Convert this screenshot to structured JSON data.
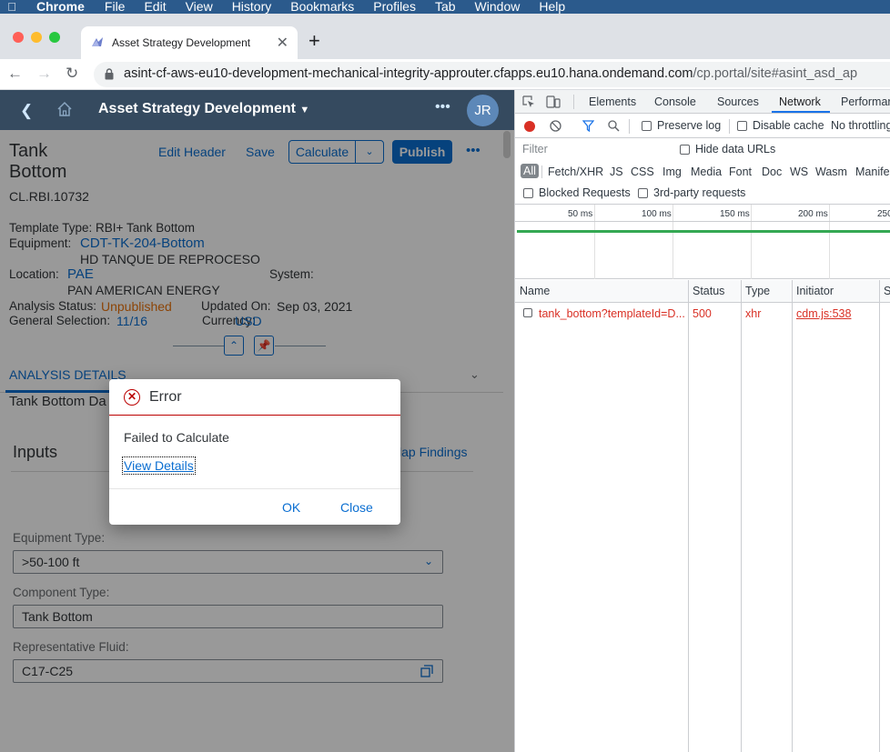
{
  "menubar": {
    "app": "Chrome",
    "items": [
      "File",
      "Edit",
      "View",
      "History",
      "Bookmarks",
      "Profiles",
      "Tab",
      "Window",
      "Help"
    ]
  },
  "browser": {
    "tab_title": "Asset Strategy Development",
    "url_main": "asint-cf-aws-eu10-development-mechanical-integrity-approuter.cfapps.eu10.hana.ondemand.com",
    "url_path": "/cp.portal/site#asint_asd_ap"
  },
  "shell": {
    "title": "Asset Strategy Development",
    "avatar": "JR"
  },
  "header": {
    "title": "Tank Bottom",
    "id": "CL.RBI.10732",
    "actions": {
      "edit_header": "Edit Header",
      "save": "Save",
      "calculate": "Calculate",
      "publish": "Publish"
    },
    "template_type": "Template Type: RBI+ Tank Bottom",
    "equipment_label": "Equipment:",
    "equipment_link": "CDT-TK-204-Bottom",
    "equipment_desc": "HD TANQUE DE REPROCESO",
    "location_label": "Location:",
    "location_link": "PAE",
    "location_desc": "PAN AMERICAN ENERGY",
    "system_label": "System:",
    "status_label": "Analysis Status:",
    "status_value": "Unpublished",
    "updated_label": "Updated On:",
    "updated_value": "Sep 03, 2021",
    "selection_label": "General Selection:",
    "selection_value": "11/16",
    "currency_label": "Currency:",
    "currency_value": "USD"
  },
  "section": {
    "tab": "ANALYSIS DETAILS",
    "subtitle": "Tank Bottom Da",
    "inputs": "Inputs",
    "map_findings": "lap Findings"
  },
  "form": {
    "equipment_type_label": "Equipment Type:",
    "equipment_type_value": ">50-100 ft",
    "component_type_label": "Component Type:",
    "component_type_value": "Tank Bottom",
    "fluid_label": "Representative Fluid:",
    "fluid_value": "C17-C25"
  },
  "dialog": {
    "title": "Error",
    "message": "Failed to Calculate",
    "details": "View Details",
    "ok": "OK",
    "close": "Close"
  },
  "devtools": {
    "tabs": [
      "Elements",
      "Console",
      "Sources",
      "Network",
      "Performar"
    ],
    "active_tab": "Network",
    "preserve_log": "Preserve log",
    "disable_cache": "Disable cache",
    "throttling": "No throttling",
    "filter_placeholder": "Filter",
    "hide_data_urls": "Hide data URLs",
    "types": [
      "All",
      "Fetch/XHR",
      "JS",
      "CSS",
      "Img",
      "Media",
      "Font",
      "Doc",
      "WS",
      "Wasm",
      "Manifes"
    ],
    "blocked_requests": "Blocked Requests",
    "third_party": "3rd-party requests",
    "ticks": [
      "50 ms",
      "100 ms",
      "150 ms",
      "200 ms",
      "250"
    ],
    "columns": [
      "Name",
      "Status",
      "Type",
      "Initiator",
      "S"
    ],
    "row": {
      "name": "tank_bottom?templateId=D...",
      "status": "500",
      "type": "xhr",
      "initiator": "cdm.js:538"
    }
  },
  "colors": {
    "shell_bg": "#354a5f",
    "accent": "#0a6ed1",
    "error": "#bb0000",
    "warning": "#e9730c",
    "devtools_error": "#d93025"
  }
}
